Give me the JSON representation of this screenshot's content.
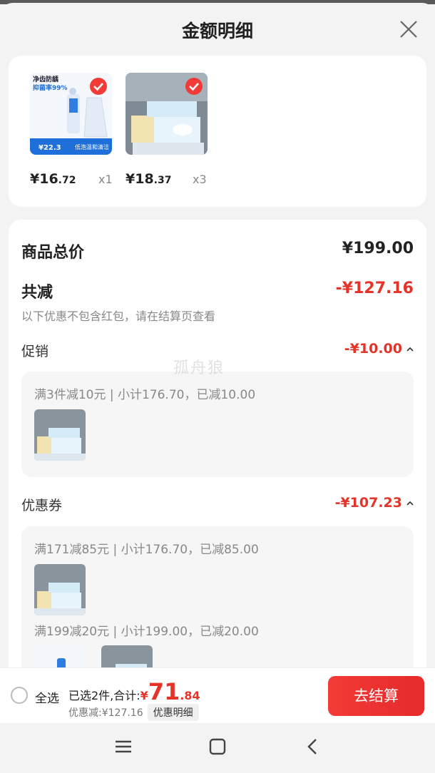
{
  "header": {
    "title": "金额明细"
  },
  "products": [
    {
      "price_int": "¥16",
      "price_dec": ".72",
      "qty": "x1",
      "thumb_lines": [
        "净齿防龋",
        "抑菌率99%",
        "¥22.3",
        "低泡温和清洁"
      ]
    },
    {
      "price_int": "¥18",
      "price_dec": ".37",
      "qty": "x3"
    }
  ],
  "summary": {
    "total_label": "商品总价",
    "total_value": "¥199.00",
    "reduce_label": "共减",
    "reduce_value": "-¥127.16",
    "note": "以下优惠不包含红包，请在结算页查看"
  },
  "promo": {
    "label": "促销",
    "value": "-¥10.00",
    "lines": [
      "满3件减10元 | 小计176.70，已减10.00"
    ]
  },
  "watermark": "孤舟狼",
  "coupon": {
    "label": "优惠券",
    "value": "-¥107.23",
    "lines": [
      "满171减85元 | 小计176.70，已减85.00",
      "满199减20元 | 小计199.00，已减20.00"
    ]
  },
  "bottom": {
    "select_all": "全选",
    "selected_text": "已选2件,合计:",
    "total_sym": "¥",
    "total_int": "71",
    "total_dec": ".84",
    "discount_text": "优惠减:¥127.16",
    "detail_label": "优惠明细",
    "checkout_label": "去结算"
  },
  "icons": {
    "close": "close-icon",
    "check": "check-badge-icon",
    "chevron": "chevron-up-icon",
    "nav": [
      "menu-icon",
      "home-icon",
      "back-icon"
    ]
  },
  "colors": {
    "accent": "#e6332a",
    "background": "#f3f3f3"
  }
}
